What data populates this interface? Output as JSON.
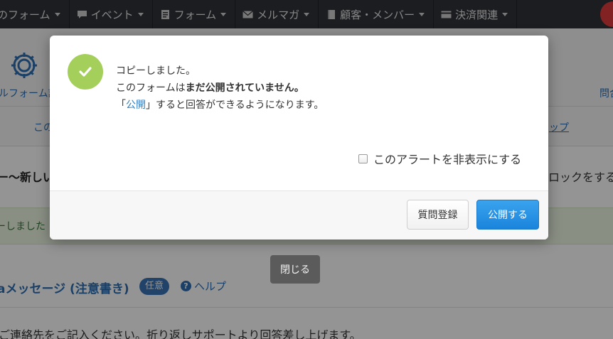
{
  "navbar": {
    "items": [
      {
        "label": "のフォーム",
        "icon": "none"
      },
      {
        "label": "イベント",
        "icon": "speech-bubble-icon"
      },
      {
        "label": "フォーム",
        "icon": "form-icon"
      },
      {
        "label": "メルマガ",
        "icon": "envelope-icon"
      },
      {
        "label": "顧客・メンバー",
        "icon": "book-icon"
      },
      {
        "label": "決済関連",
        "icon": "credit-card-icon"
      }
    ]
  },
  "background": {
    "gear_label": "ルフォーム設",
    "right_link": "問合",
    "tab_left": "この",
    "tab_right": "ップ",
    "title": "ー～新しい",
    "right_text": "ロックをする",
    "notice": "ーしました",
    "section_title": "aメッセージ (注意書き)",
    "badge": "任意",
    "help": "ヘルプ",
    "bottom_text": "ご連絡先をご記入ください。折り返しサポートより回答差し上げます。"
  },
  "modal": {
    "line1": "コピーしました。",
    "line2_prefix": "このフォームは",
    "line2_bold": "まだ公開されていません。",
    "line3_open": "「",
    "line3_link": "公開",
    "line3_rest": "」すると回答ができるようになります。",
    "hide_alert_label": "このアラートを非表示にする",
    "question_register_button": "質問登録",
    "publish_button": "公開する"
  },
  "close_button": "閉じる",
  "colors": {
    "success": "#a3cf5a",
    "primary": "#1a84dc",
    "link": "#2d7fc1"
  }
}
